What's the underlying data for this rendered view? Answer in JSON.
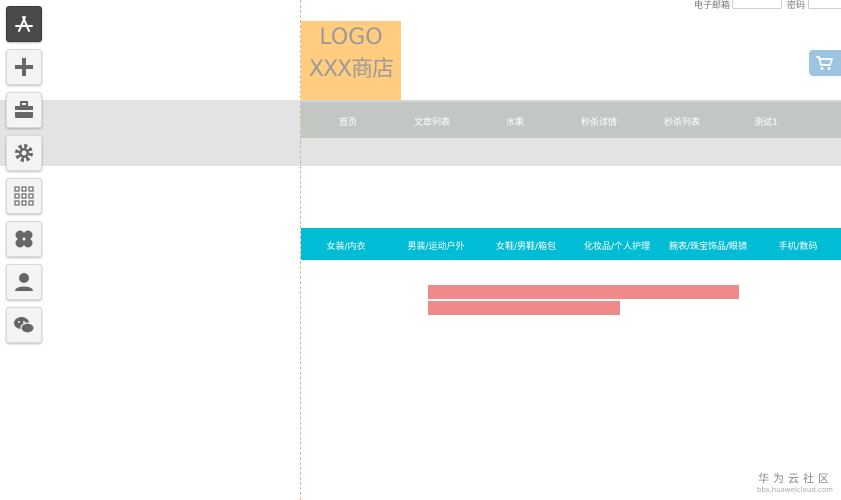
{
  "topbar": {
    "email_label": "电子邮箱",
    "password_label": "密码"
  },
  "logo": {
    "line1": "LOGO",
    "line2": "XXX商店"
  },
  "toolbar": {
    "icons": [
      "app-store-icon",
      "plus-icon",
      "toolbox-icon",
      "gear-icon",
      "grid-icon",
      "clover-icon",
      "user-icon",
      "wechat-icon"
    ]
  },
  "nav_main": [
    "首页",
    "文章列表",
    "水果",
    "秒杀详情",
    "秒杀列表",
    "测试1"
  ],
  "nav_category": [
    "女装/内衣",
    "男装/运动户外",
    "女鞋/男鞋/箱包",
    "化妆品/个人护理",
    "腕表/珠宝饰品/眼镜",
    "手机/数码"
  ],
  "watermark": {
    "title": "华为云社区",
    "url": "bbs.huaweicloud.com"
  },
  "colors": {
    "logo_bg": "#ffcc80",
    "nav_bg": "#c3c7c3",
    "category_bg": "#00bcd4",
    "highlight": "#f08a8a",
    "cart_bg": "#9cc3e0"
  }
}
